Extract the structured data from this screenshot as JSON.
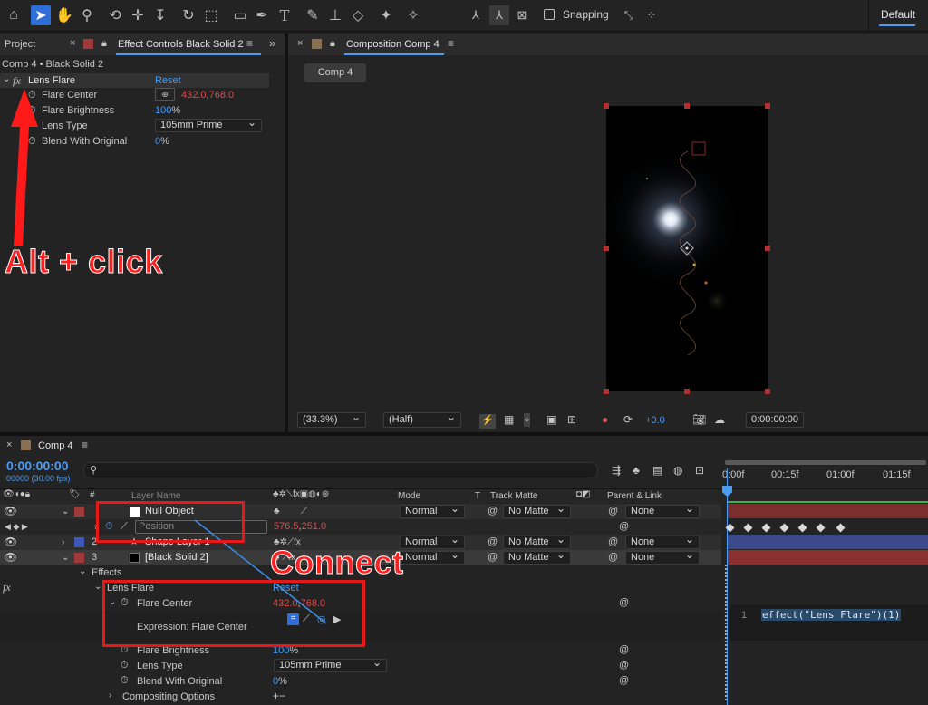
{
  "toolbar": {
    "snapping_label": "Snapping",
    "workspace": "Default"
  },
  "left_panel": {
    "tab_project": "Project",
    "tab_effect_controls": "Effect Controls Black Solid 2",
    "breadcrumb": "Comp 4 • Black Solid 2",
    "effect_name": "Lens Flare",
    "reset": "Reset",
    "props": [
      {
        "name": "Flare Center",
        "v1": "432.0",
        "sep": ",",
        "v2": "768.0"
      },
      {
        "name": "Flare Brightness",
        "v1": "100",
        "unit": "%"
      },
      {
        "name": "Lens Type",
        "value": "105mm Prime"
      },
      {
        "name": "Blend With Original",
        "v1": "0",
        "unit": "%"
      }
    ]
  },
  "comp_panel": {
    "tab": "Composition Comp 4",
    "comp_tab": "Comp 4",
    "zoom": "(33.3%)",
    "resolution": "(Half)",
    "exposure": "+0.0",
    "timecode": "0:00:00:00"
  },
  "timeline": {
    "tab": "Comp 4",
    "timecode": "0:00:00:00",
    "frames": "00000 (30.00 fps)",
    "search_placeholder": "",
    "ruler": [
      "0:00f",
      "00:15f",
      "01:00f",
      "01:15f"
    ],
    "col_headers": {
      "num": "#",
      "layer_name": "Layer Name",
      "mode": "Mode",
      "t": "T",
      "track_matte": "Track Matte",
      "parent": "Parent & Link"
    },
    "layers": [
      {
        "num": "1",
        "name": "Null Object",
        "mode": "Normal",
        "matte": "No Matte",
        "parent": "None",
        "color": "#a03a3a"
      },
      {
        "prop": "Position",
        "v1": "576.5",
        "v2": "251.0"
      },
      {
        "num": "2",
        "name": "Shape Layer 1",
        "mode": "Normal",
        "matte": "No Matte",
        "parent": "None",
        "color": "#3d58b8"
      },
      {
        "num": "3",
        "name": "[Black Solid 2]",
        "mode": "Normal",
        "matte": "No Matte",
        "parent": "None",
        "color": "#a03a3a"
      }
    ],
    "effects_label": "Effects",
    "lens_flare": "Lens Flare",
    "reset": "Reset",
    "flare_center": "Flare Center",
    "fc_v1": "432.0",
    "fc_v2": "768.0",
    "expression_label": "Expression: Flare Center",
    "flare_brightness": "Flare Brightness",
    "fb_value": "100",
    "fb_unit": "%",
    "lens_type": "Lens Type",
    "lens_type_value": "105mm Prime",
    "blend": "Blend With Original",
    "blend_value": "0",
    "blend_unit": "%",
    "compositing": "Compositing Options",
    "expr_line": "1",
    "expr_code": "effect(\"Lens Flare\")(1)"
  },
  "annotations": {
    "alt_click": "Alt + click",
    "connect": "Connect"
  }
}
